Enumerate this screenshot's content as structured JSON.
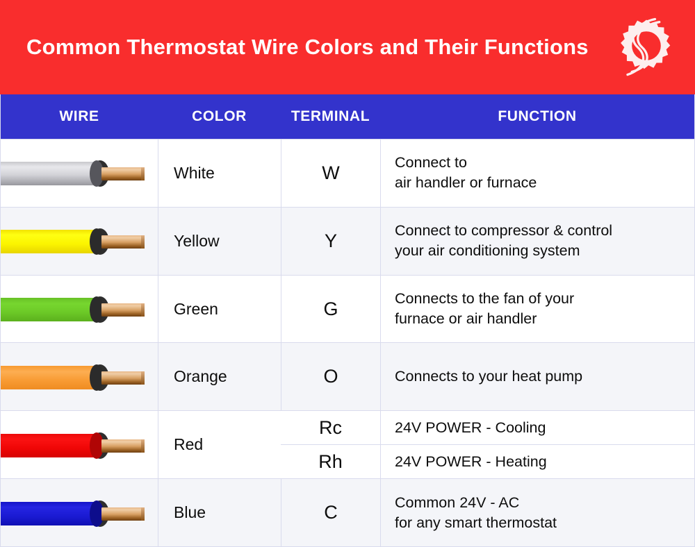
{
  "banner": {
    "title": "Common Thermostat Wire Colors and Their Functions",
    "background_color": "#f92d2d",
    "logo_name": "gear-swirl-logo"
  },
  "table": {
    "header_background": "#3333cc",
    "headers": {
      "wire": "WIRE",
      "color": "COLOR",
      "terminal": "TERMINAL",
      "function": "FUNCTION"
    },
    "rows": [
      {
        "color_name": "White",
        "wire_color_hex": "#d3d3d8",
        "terminal": "W",
        "function_lines": [
          "Connect to",
          "air handler or furnace"
        ],
        "shaded": false
      },
      {
        "color_name": "Yellow",
        "wire_color_hex": "#ffff12",
        "terminal": "Y",
        "function_lines": [
          "Connect to compressor & control",
          "your air conditioning system"
        ],
        "shaded": true
      },
      {
        "color_name": "Green",
        "wire_color_hex": "#77d62f",
        "terminal": "G",
        "function_lines": [
          "Connects to the fan of your",
          "furnace or air handler"
        ],
        "shaded": false
      },
      {
        "color_name": "Orange",
        "wire_color_hex": "#fdae52",
        "terminal": "O",
        "function_lines": [
          "Connects to your heat pump"
        ],
        "shaded": true
      },
      {
        "color_name": "Red",
        "wire_color_hex": "#fb1313",
        "shaded": false,
        "split": [
          {
            "terminal": "Rc",
            "function_lines": [
              "24V POWER - Cooling"
            ]
          },
          {
            "terminal": "Rh",
            "function_lines": [
              "24V POWER - Heating"
            ]
          }
        ]
      },
      {
        "color_name": "Blue",
        "wire_color_hex": "#2525e2",
        "terminal": "C",
        "function_lines": [
          "Common 24V - AC",
          "for any smart thermostat"
        ],
        "shaded": true
      }
    ]
  }
}
